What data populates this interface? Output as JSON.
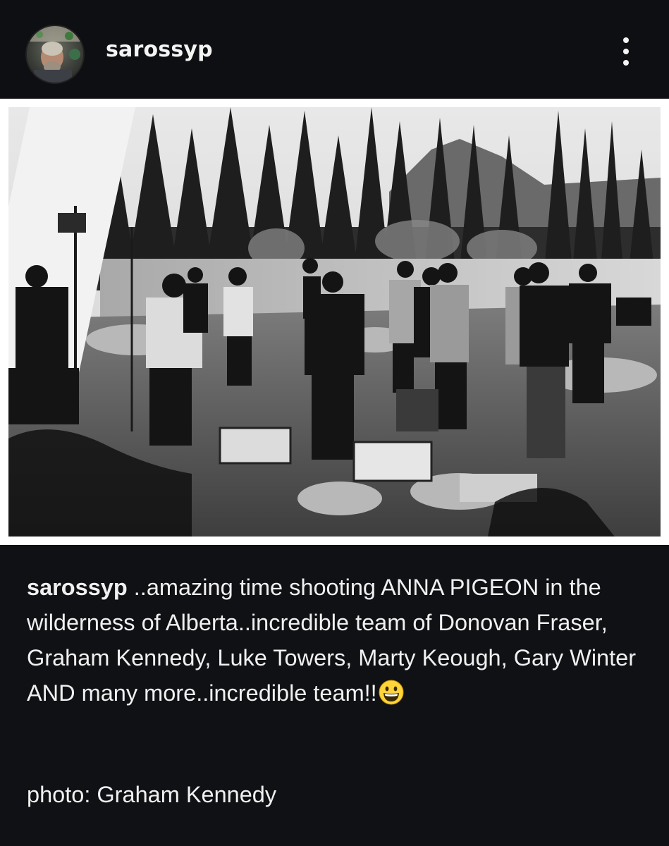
{
  "post": {
    "username": "sarossyp",
    "more_icon": "more-vertical-icon",
    "avatar_icon": "avatar"
  },
  "photo": {
    "subject": "photo",
    "style": "black-and-white"
  },
  "caption": {
    "author": "sarossyp",
    "text": " ..amazing time shooting ANNA PIGEON in the wilderness of Alberta..incredible team of Donovan Fraser, Graham Kennedy, Luke Towers, Marty Keough, Gary Winter AND many more..incredible team!!",
    "emoji": "grinning-face-emoji",
    "credit": "photo: Graham Kennedy"
  },
  "colors": {
    "background": "#101114",
    "text": "#f0f0f0",
    "frame": "#ffffff"
  }
}
